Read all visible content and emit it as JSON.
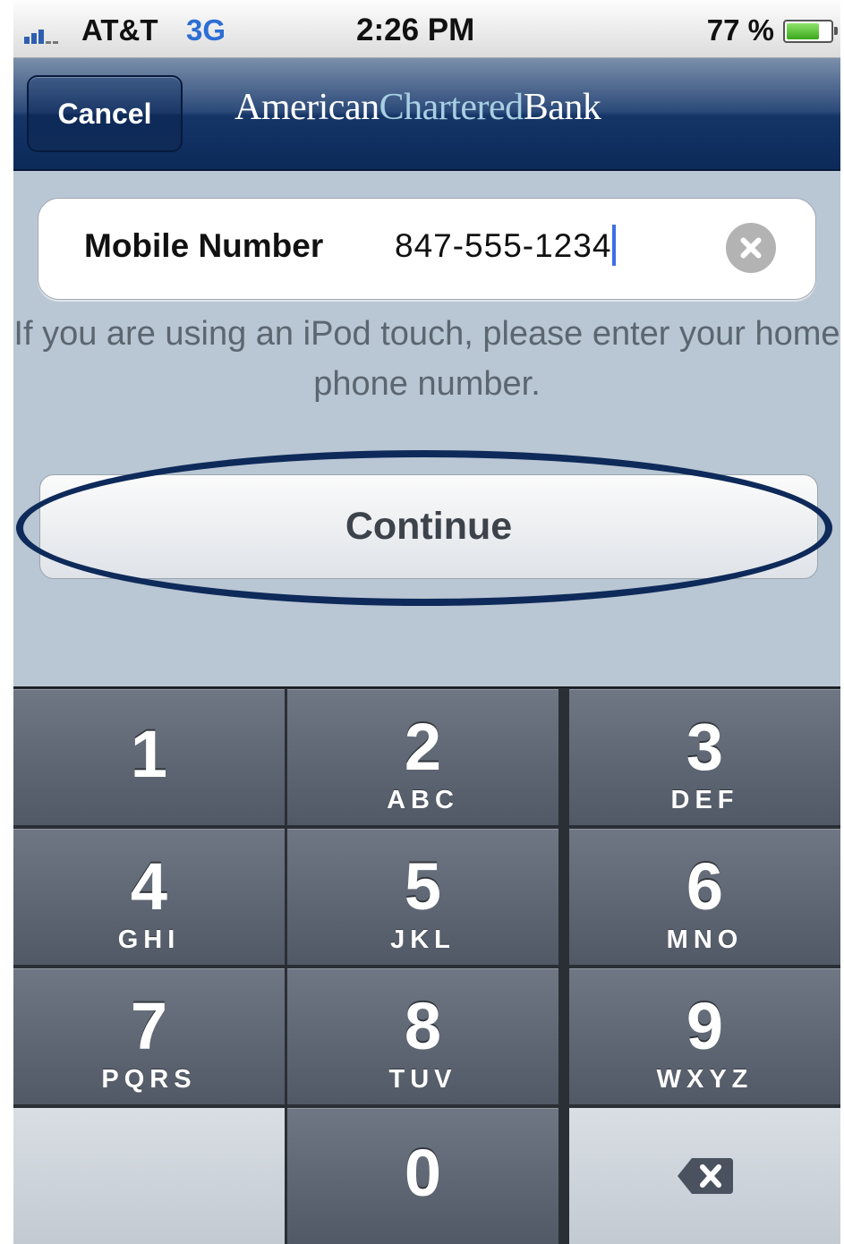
{
  "status_bar": {
    "carrier": "AT&T",
    "network": "3G",
    "time": "2:26 PM",
    "battery_percent": "77 %",
    "battery_level": 0.77
  },
  "nav_bar": {
    "cancel_label": "Cancel",
    "brand_part1": "American",
    "brand_part2": "Chartered",
    "brand_part3": "Bank"
  },
  "form": {
    "field_label": "Mobile Number",
    "field_value": "847-555-1234",
    "helper_text": "If you are using an iPod touch, please enter your home phone number.",
    "continue_label": "Continue"
  },
  "keypad": {
    "keys": [
      {
        "digit": "1",
        "letters": ""
      },
      {
        "digit": "2",
        "letters": "ABC"
      },
      {
        "digit": "3",
        "letters": "DEF"
      },
      {
        "digit": "4",
        "letters": "GHI"
      },
      {
        "digit": "5",
        "letters": "JKL"
      },
      {
        "digit": "6",
        "letters": "MNO"
      },
      {
        "digit": "7",
        "letters": "PQRS"
      },
      {
        "digit": "8",
        "letters": "TUV"
      },
      {
        "digit": "9",
        "letters": "WXYZ"
      },
      {
        "digit": "0",
        "letters": ""
      }
    ],
    "delete_icon": "backspace-icon"
  },
  "colors": {
    "nav_bar": "#153567",
    "brand_accent": "#a8cfe3",
    "network": "#2c6ed4",
    "highlight_ellipse": "#0e2a5a",
    "background": "#b9c6d3"
  }
}
